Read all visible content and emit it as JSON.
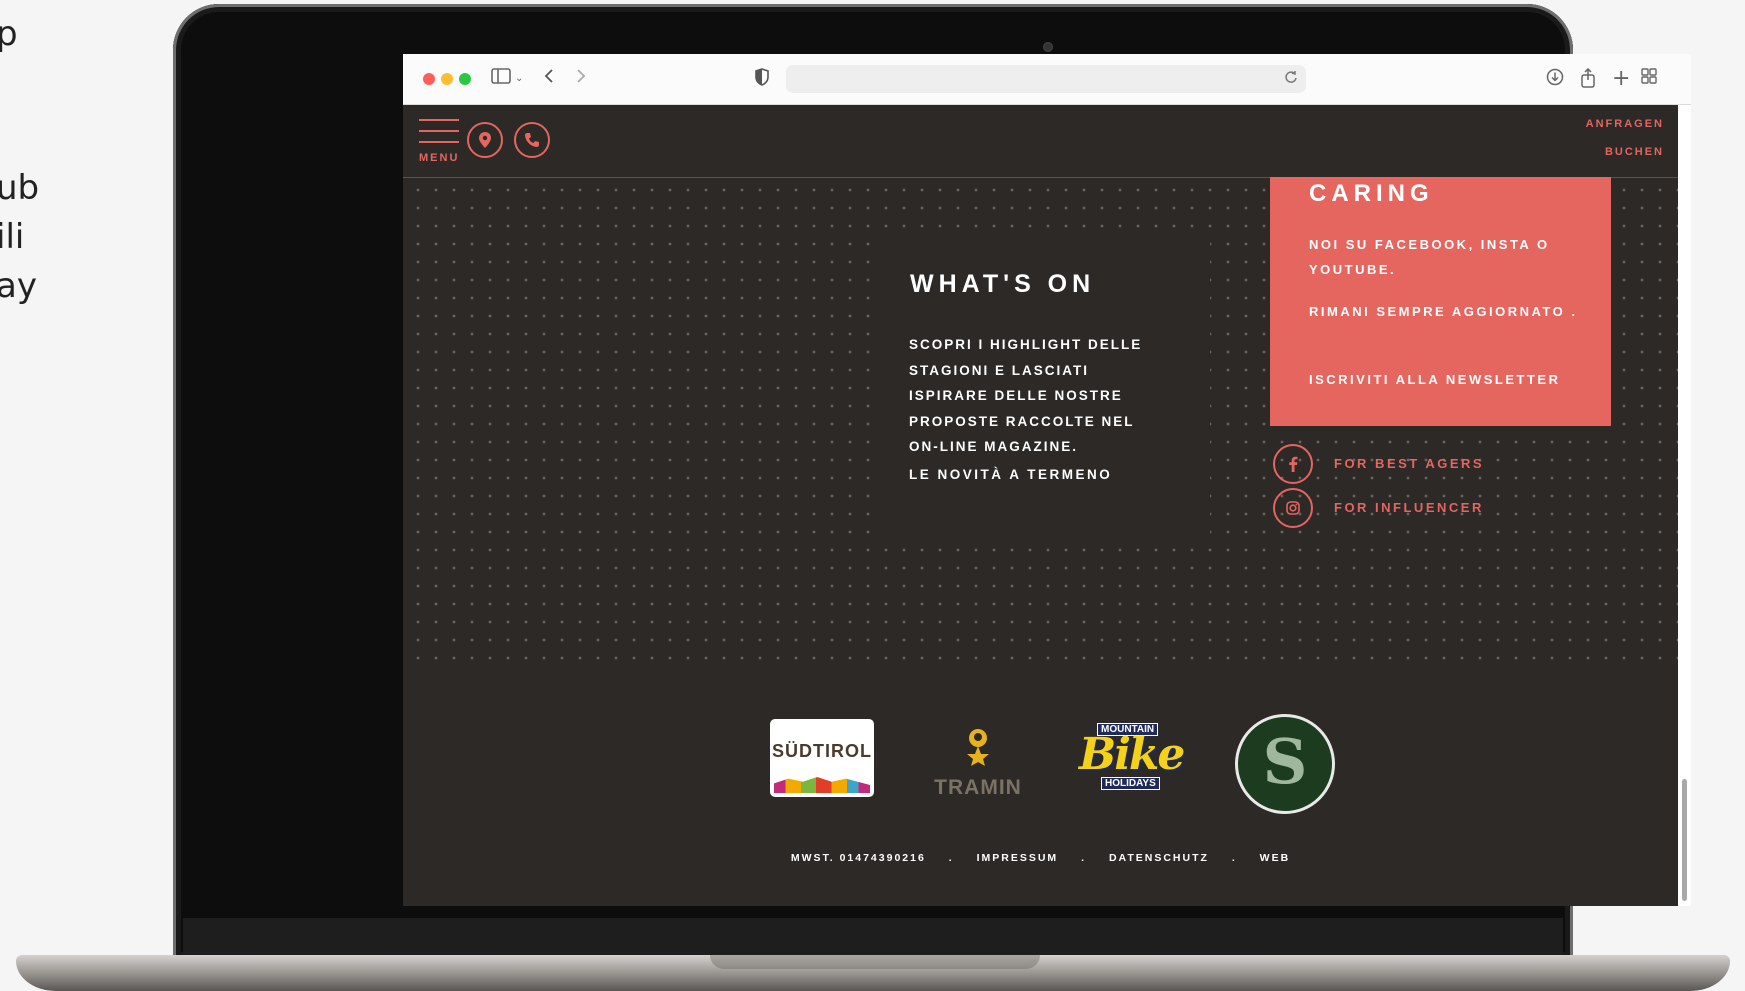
{
  "side_text": {
    "line1": "p",
    "line2": "ub",
    "line3": "ili",
    "line4": "ay"
  },
  "browser": {
    "url": "",
    "icons": {
      "sidebar": "sidebar-icon",
      "back": "chevron-left-icon",
      "forward": "chevron-right-icon",
      "shield": "shield-icon",
      "reload": "reload-icon",
      "download": "download-icon",
      "share": "share-icon",
      "new_tab": "plus-icon",
      "tabs": "tab-overview-icon"
    },
    "colors": {
      "close": "#ff5f57",
      "minimize": "#febc2e",
      "zoom": "#28c840"
    }
  },
  "site": {
    "header": {
      "menu_label": "MENU",
      "anfragen": "ANFRAGEN",
      "buchen": "BUCHEN",
      "accent": "#e5655f"
    },
    "whats_on": {
      "title": "WHAT'S ON",
      "body": "SCOPRI I HIGHLIGHT DELLE STAGIONI E LASCIATI ISPIRARE DELLE NOSTRE PROPOSTE RACCOLTE NEL ON-LINE MAGAZINE.",
      "link": "LE NOVITÀ A TERMENO"
    },
    "caring_box": {
      "title": "CARING",
      "p1": "NOI SU FACEBOOK, INSTA O YOUTUBE.",
      "p2": "RIMANI SEMPRE AGGIORNATO .",
      "p3": "ISCRIVITI ALLA NEWSLETTER",
      "background": "#e5655f"
    },
    "social": [
      {
        "icon": "facebook-icon",
        "label": "FOR BEST AGERS"
      },
      {
        "icon": "instagram-icon",
        "label": "FOR INFLUENCER"
      }
    ],
    "logos": {
      "suedtirol": "SÜDTIROL",
      "tramin": "TRAMIN",
      "bike_top": "MOUNTAIN",
      "bike_main": "Bike",
      "bike_bottom": "HOLIDAYS",
      "seal": "S"
    },
    "footer": {
      "mwst": "MWST. 01474390216",
      "sep": ".",
      "impressum": "IMPRESSUM",
      "datenschutz": "DATENSCHUTZ",
      "web": "WEB"
    }
  }
}
